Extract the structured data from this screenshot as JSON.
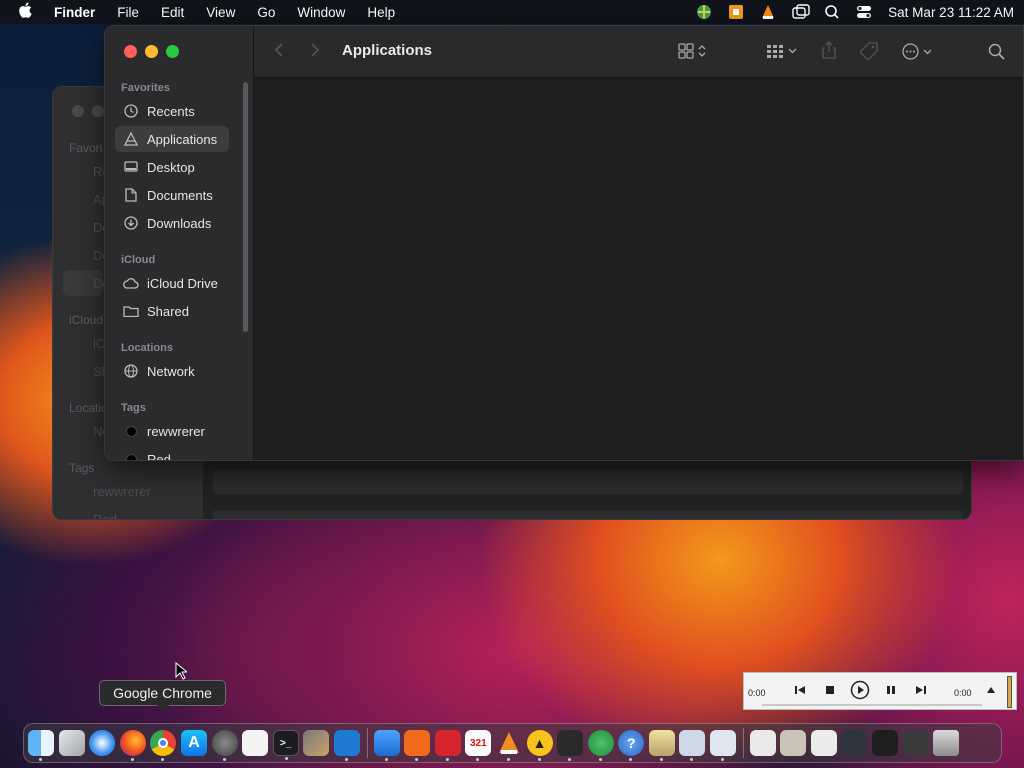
{
  "menubar": {
    "app_name": "Finder",
    "menus": [
      "File",
      "Edit",
      "View",
      "Go",
      "Window",
      "Help"
    ],
    "clock": "Sat Mar 23  11:22 AM"
  },
  "finder": {
    "title": "Applications",
    "sidebar": {
      "favorites_label": "Favorites",
      "favorites": [
        "Recents",
        "Applications",
        "Desktop",
        "Documents",
        "Downloads"
      ],
      "icloud_label": "iCloud",
      "icloud": [
        "iCloud Drive",
        "Shared"
      ],
      "locations_label": "Locations",
      "locations": [
        "Network"
      ],
      "tags_label": "Tags",
      "tags": [
        "rewwrerer",
        "Red"
      ]
    }
  },
  "back_window": {
    "labels": [
      "Favori",
      "iCloud",
      "Locatio",
      "Tags"
    ],
    "items": [
      "Re",
      "Ap",
      "De",
      "Do",
      "De",
      "iC",
      "Sh",
      "Ne",
      "rewwrerer",
      "Red"
    ]
  },
  "tooltip": {
    "text": "Google Chrome"
  },
  "player": {
    "elapsed": "0:00",
    "total": "0:00"
  },
  "dock": {
    "apps": [
      "finder-icon",
      "launchpad-icon",
      "safari-icon",
      "firefox-icon",
      "chrome-icon",
      "app-store-icon",
      "system-settings-icon",
      "textedit-icon",
      "terminal-icon",
      "brush-icon",
      "vscode-icon",
      "cloud-icon",
      "screen-share-icon",
      "fantastical-icon",
      "calendar-321-icon",
      "vlc-icon",
      "amphetamine-icon",
      "layers-icon",
      "globe-icon",
      "help-icon",
      "mail-icon",
      "photos-icon",
      "preview-icon",
      "window-1-icon",
      "window-2-icon",
      "window-3-icon",
      "window-4-icon",
      "window-5-icon",
      "window-6-icon",
      "trash-icon"
    ]
  },
  "colors": {
    "accent": "#3d3d40",
    "close": "#fe5f57",
    "minimize": "#febc2e",
    "maximize": "#28c840"
  }
}
